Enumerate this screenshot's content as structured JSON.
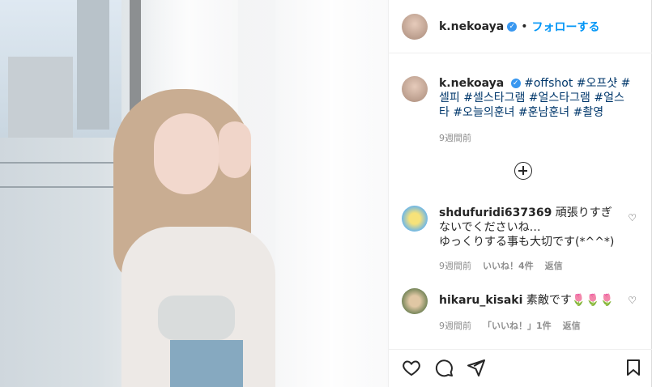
{
  "post": {
    "photo_alt": "",
    "header": {
      "username": "k.nekoaya",
      "verified_mark": "✓",
      "separator": "•",
      "follow_label": "フォローする"
    },
    "caption": {
      "username": "k.nekoaya",
      "verified_mark": "✓",
      "text": "#offshot #오프샷 #셀피 #셀스타그램 #얼스타그램 #얼스타 #오늘의훈녀 #훈남훈녀 #촬영",
      "time": "9週間前"
    },
    "comments": [
      {
        "username": "shdufuridi637369",
        "text": "頑張りすぎないでくださいね…\nゆっくりする事も大切です(*^^*)",
        "time": "9週間前",
        "likes": "いいね！4件",
        "reply": "返信"
      },
      {
        "username": "hikaru_kisaki",
        "text": "素敵です🌷🌷🌷",
        "time": "9週間前",
        "likes": "「いいね！」1件",
        "reply": "返信"
      }
    ]
  },
  "colors": {
    "accent": "#0095f6",
    "hashtag": "#00376b",
    "muted": "#8e8e8e"
  },
  "icons": {
    "like": "heart-icon",
    "comment": "comment-icon",
    "share": "share-icon",
    "save": "bookmark-icon",
    "load_more": "plus-circle-icon"
  }
}
